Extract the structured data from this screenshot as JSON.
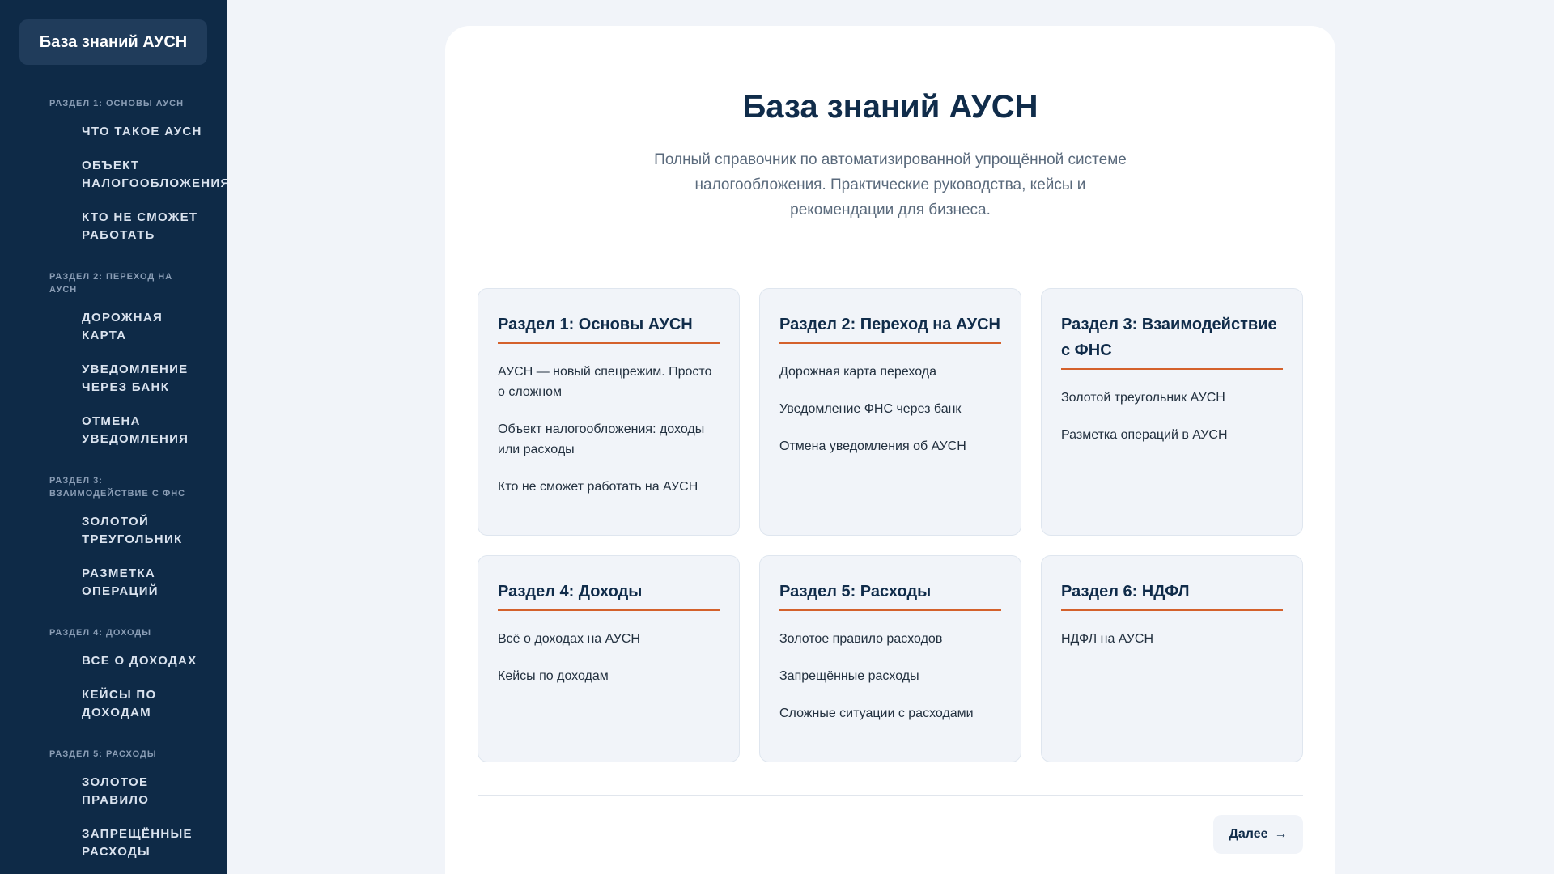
{
  "sidebar": {
    "brand": "База знаний АУСН",
    "nav": [
      {
        "section": "Раздел 1: Основы АУСН",
        "items": [
          "Что такое АУСН",
          "Объект налогообложения",
          "Кто не сможет работать"
        ]
      },
      {
        "section": "Раздел 2: Переход на АУСН",
        "items": [
          "Дорожная карта",
          "Уведомление через банк",
          "Отмена уведомления"
        ]
      },
      {
        "section": "Раздел 3: Взаимодействие с ФНС",
        "items": [
          "Золотой треугольник",
          "Разметка операций"
        ]
      },
      {
        "section": "Раздел 4: Доходы",
        "items": [
          "Все о доходах",
          "Кейсы по доходам"
        ]
      },
      {
        "section": "Раздел 5: Расходы",
        "items": [
          "Золотое правило",
          "Запрещённые расходы"
        ]
      }
    ]
  },
  "main": {
    "title": "База знаний АУСН",
    "subtitle": "Полный справочник по автоматизированной упрощённой системе налогообложения. Практические руководства, кейсы и рекомендации для бизнеса.",
    "cards": [
      {
        "title": "Раздел 1: Основы АУСН",
        "links": [
          "АУСН — новый спецрежим. Просто о сложном",
          "Объект налогообложения: доходы или расходы",
          "Кто не сможет работать на АУСН"
        ]
      },
      {
        "title": "Раздел 2: Переход на АУСН",
        "links": [
          "Дорожная карта перехода",
          "Уведомление ФНС через банк",
          "Отмена уведомления об АУСН"
        ]
      },
      {
        "title": "Раздел 3: Взаимодействие с ФНС",
        "links": [
          "Золотой треугольник АУСН",
          "Разметка операций в АУСН"
        ]
      },
      {
        "title": "Раздел 4: Доходы",
        "links": [
          "Всё о доходах на АУСН",
          "Кейсы по доходам"
        ]
      },
      {
        "title": "Раздел 5: Расходы",
        "links": [
          "Золотое правило расходов",
          "Запрещённые расходы",
          "Сложные ситуации с расходами"
        ]
      },
      {
        "title": "Раздел 6: НДФЛ",
        "links": [
          "НДФЛ на АУСН"
        ]
      }
    ],
    "next_label": "Далее",
    "next_arrow": "→"
  },
  "colors": {
    "sidebar_bg": "#0e2a47",
    "accent": "#d4612c",
    "title": "#102c4a"
  }
}
